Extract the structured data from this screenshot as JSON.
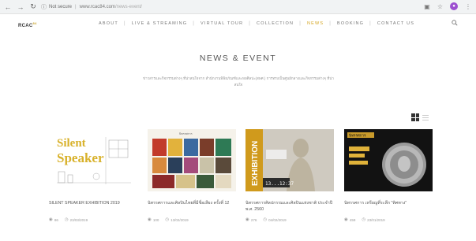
{
  "browser": {
    "security_label": "Not secure",
    "url_host": "www.rcac84.com",
    "url_path": "/news-event/"
  },
  "header": {
    "logo": "RCAC",
    "logo_sup": "84",
    "menu": [
      "ABOUT",
      "LIVE & STREAMING",
      "VIRTUAL TOUR",
      "COLLECTION",
      "NEWS",
      "BOOKING",
      "CONTACT US"
    ],
    "active_item": "NEWS"
  },
  "page": {
    "title": "NEWS & EVENT",
    "intro": "ข่าวสารและกิจกรรมต่างๆ ที่น่าสนใจจาก สำนักงานพิพิธภัณฑ์และหอศิลปะ(สพศ.) การทรงเป็นศูนย์กลางและกิจกรรมต่างๆ ที่น่าสนใจ"
  },
  "cards": [
    {
      "title": "SILENT SPEAKER EXHIBITION 2019",
      "views": "86",
      "date": "23/03/2019",
      "thumb_text_1": "Silent",
      "thumb_text_2": "Speaker"
    },
    {
      "title": "นิทรรศการและศิลปินไทยที่มีชื่อเสียง ครั้งที่ 12",
      "views": "100",
      "date": "13/02/2019",
      "thumb_text_1": "นิทรรศการ"
    },
    {
      "title": "นิทรรศการศิลปกรรมและศิลปินแห่งชาติ ประจำปี พ.ศ. 2560",
      "views": "276",
      "date": "04/02/2019",
      "thumb_text_1": "EXHIBITION",
      "thumb_text_2": "13...12:37"
    },
    {
      "title": "นิทรรศการ เหรียญที่ระลึก \"ทิศทาง\"",
      "views": "459",
      "date": "23/01/2019",
      "thumb_text_1": "นิทรรศการ"
    }
  ]
}
